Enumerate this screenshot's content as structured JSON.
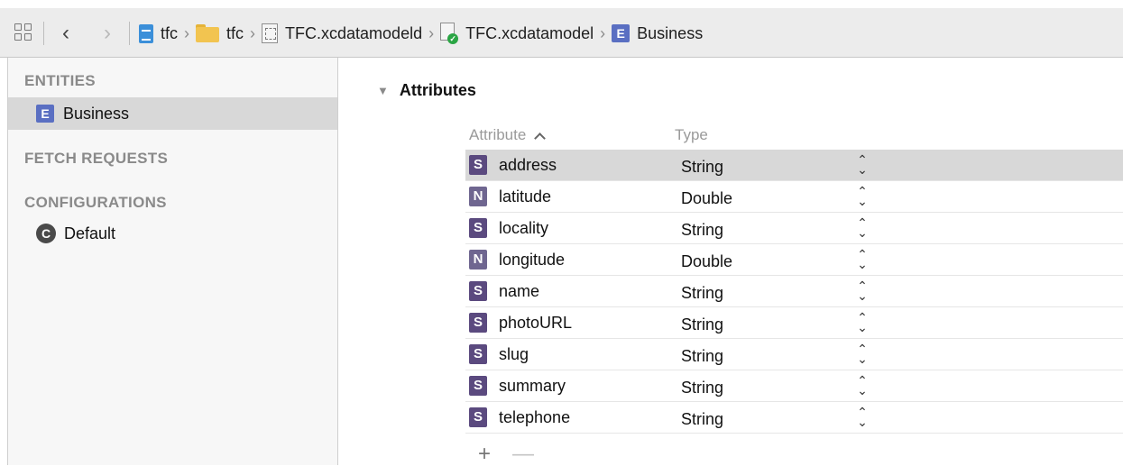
{
  "jumpbar": {
    "crumbs": [
      {
        "label": "tfc",
        "icon": "project-file-icon"
      },
      {
        "label": "tfc",
        "icon": "folder-icon"
      },
      {
        "label": "TFC.xcdatamodeld",
        "icon": "datamodel-bundle-icon"
      },
      {
        "label": "TFC.xcdatamodel",
        "icon": "datamodel-version-icon"
      },
      {
        "label": "Business",
        "icon": "entity-icon"
      }
    ],
    "entity_badge": "E",
    "back_glyph": "‹",
    "forward_glyph": "›"
  },
  "sidebar": {
    "entities_header": "ENTITIES",
    "entities": [
      {
        "label": "Business",
        "badge": "E",
        "selected": true
      }
    ],
    "fetch_header": "FETCH REQUESTS",
    "config_header": "CONFIGURATIONS",
    "configurations": [
      {
        "label": "Default",
        "badge": "C"
      }
    ]
  },
  "main": {
    "section_title": "Attributes",
    "columns": {
      "attribute": "Attribute",
      "type": "Type"
    },
    "sort_glyph": "^",
    "attributes": [
      {
        "badge": "S",
        "name": "address",
        "type": "String",
        "selected": true
      },
      {
        "badge": "N",
        "name": "latitude",
        "type": "Double"
      },
      {
        "badge": "S",
        "name": "locality",
        "type": "String"
      },
      {
        "badge": "N",
        "name": "longitude",
        "type": "Double"
      },
      {
        "badge": "S",
        "name": "name",
        "type": "String"
      },
      {
        "badge": "S",
        "name": "photoURL",
        "type": "String"
      },
      {
        "badge": "S",
        "name": "slug",
        "type": "String"
      },
      {
        "badge": "S",
        "name": "summary",
        "type": "String"
      },
      {
        "badge": "S",
        "name": "telephone",
        "type": "String"
      }
    ],
    "add_glyph": "+",
    "remove_glyph": "—"
  },
  "colors": {
    "string_badge": "#5b4a7f",
    "number_badge": "#6f6690",
    "entity_badge": "#5a6fc2",
    "selection": "#d8d8d8"
  }
}
